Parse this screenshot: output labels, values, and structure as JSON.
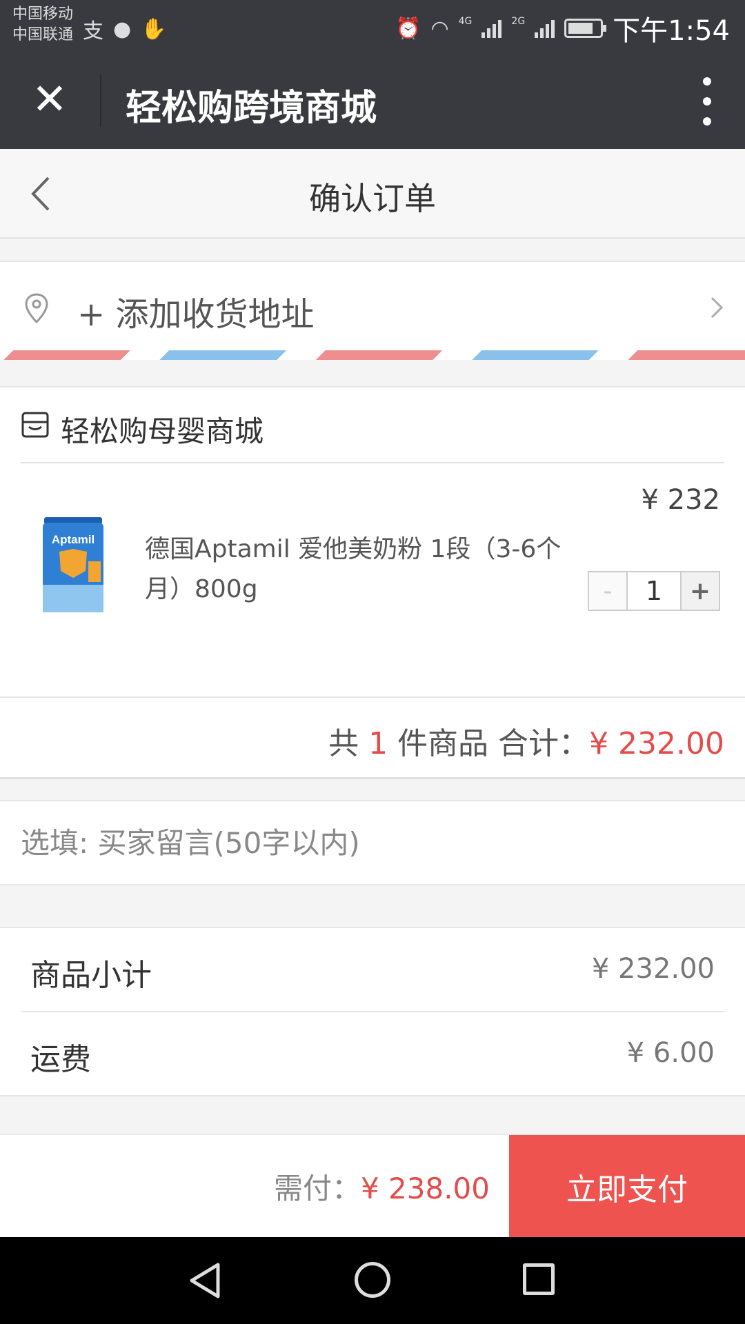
{
  "status_bar": {
    "carrier_1": "中国移动",
    "carrier_2": "中国联通",
    "net_4g": "4G",
    "net_2g": "2G",
    "time": "下午1:54",
    "battery_level": 0.8
  },
  "app_bar": {
    "title": "轻松购跨境商城"
  },
  "page": {
    "title": "确认订单"
  },
  "address": {
    "add_label": "+ 添加收货地址"
  },
  "shop": {
    "name": "轻松购母婴商城",
    "product": {
      "title": "德国Aptamil 爱他美奶粉 1段（3-6个月）800g",
      "price": "¥ 232",
      "quantity": "1",
      "minus": "-",
      "plus": "+",
      "image_brand": "Aptamil"
    },
    "footer": {
      "prefix": "共",
      "count": "1",
      "middle": "件商品 合计：",
      "total": "¥ 232.00"
    }
  },
  "message": {
    "placeholder": "选填: 买家留言(50字以内)"
  },
  "summary": {
    "subtotal_label": "商品小计",
    "subtotal_value": "¥ 232.00",
    "shipping_label": "运费",
    "shipping_value": "¥ 6.00"
  },
  "pay_bar": {
    "need_pay_label": "需付：",
    "need_pay_value": "¥ 238.00",
    "pay_button": "立即支付"
  },
  "colors": {
    "accent_red": "#ef5350",
    "price_red": "#e44c4c",
    "header_dark": "#393a3f"
  }
}
